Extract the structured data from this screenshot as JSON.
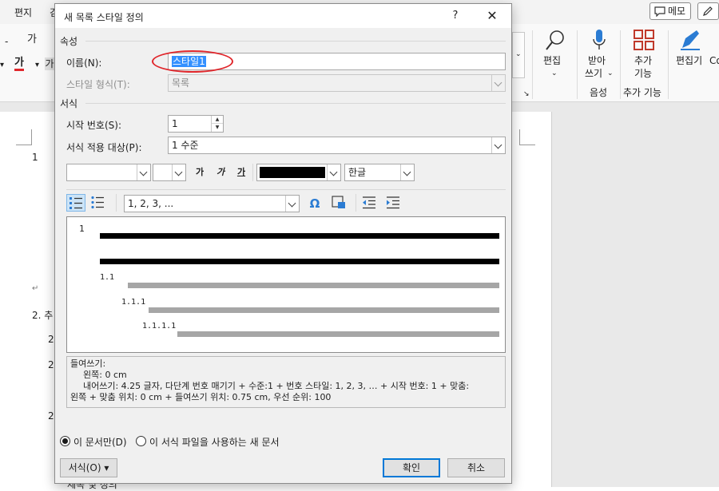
{
  "app": {
    "ribbon_tabs": {
      "edit": "편지",
      "g": "검"
    },
    "memo_button": "메모",
    "ribbon": {
      "font_small": "가",
      "font_a": "가",
      "char_border": "가",
      "edit_label": "편집",
      "dictate_label_1": "받아",
      "dictate_label_2": "쓰기",
      "addin_label_1": "추가",
      "addin_label_2": "기능",
      "editor_label": "편집기",
      "co_label": "Co",
      "group_voice": "음성",
      "group_addins": "추가 기능"
    },
    "document": {
      "line_1": "1",
      "line_2": "2. 추",
      "line_3": "2",
      "line_4": "2",
      "line_5": "2",
      "footer_text": "제목 및 정의"
    }
  },
  "dialog": {
    "title": "새 목록 스타일 정의",
    "help_label": "?",
    "close_label": "✕",
    "properties": {
      "section": "속성",
      "name_label": "이름(N):",
      "name_value": "스타일1",
      "style_type_label": "스타일 형식(T):",
      "style_type_value": "목록"
    },
    "format": {
      "section": "서식",
      "start_at_label": "시작 번호(S):",
      "start_at_value": "1",
      "apply_to_label": "서식 적용 대상(P):",
      "apply_to_value": "1 수준",
      "font_name_value": "",
      "font_size_value": "",
      "bold_label": "가",
      "italic_label": "가",
      "underline_label": "가",
      "font_color": "#000000",
      "language_value": "한글",
      "number_style_value": "1, 2, 3, ...",
      "symbol_label": "Ω"
    },
    "preview": {
      "level_1": "1",
      "level_2": "1.1",
      "level_3": "1.1.1",
      "level_4": "1.1.1.1"
    },
    "description": {
      "line_1": "들여쓰기:",
      "line_2": "왼쪽:  0 cm",
      "line_3": "내어쓰기:  4.25 글자, 다단계 번호 매기기 + 수준:1 + 번호 스타일: 1, 2, 3, … + 시작 번호: 1 + 맞춤:",
      "line_4": "왼쪽 + 맞춤 위치: 0 cm + 들여쓰기 위치: 0.75 cm, 우선 순위: 100"
    },
    "options": {
      "this_document": "이 문서만(D)",
      "new_documents": "이 서식 파일을 사용하는 새 문서"
    },
    "buttons": {
      "format": "서식(O) ▾",
      "ok": "확인",
      "cancel": "취소"
    },
    "colors": {
      "accent": "#0078d7",
      "highlight": "#e0262b"
    }
  }
}
